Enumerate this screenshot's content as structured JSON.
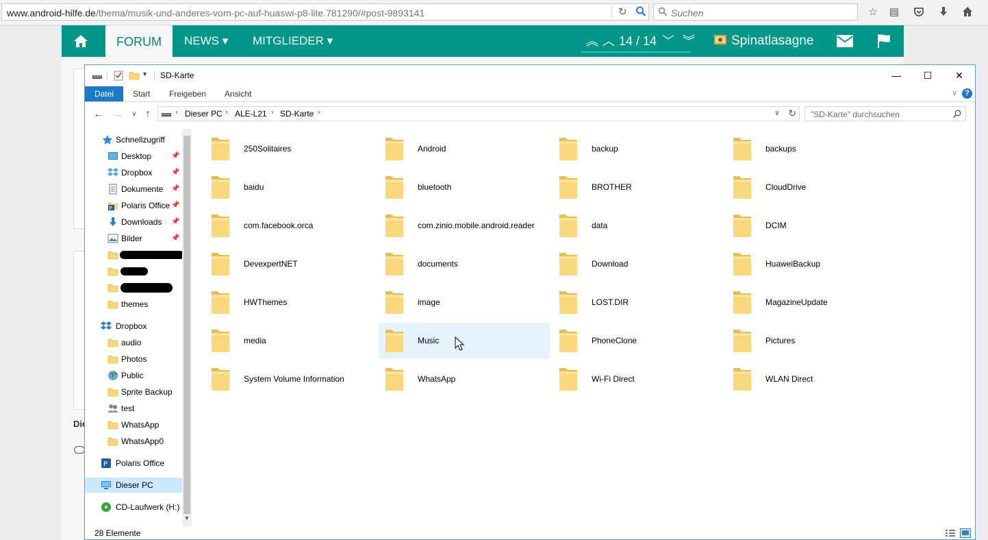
{
  "browser": {
    "url_domain": "www.android-hilfe.de",
    "url_path": "/thema/musik-und-anderes-vom-pc-auf-huaswi-p8-lite.781290/#post-9893141",
    "search_placeholder": "Suchen",
    "toolbar_icons": [
      "star-icon",
      "reading-list-icon",
      "pocket-icon",
      "download-icon",
      "home-icon"
    ]
  },
  "forum_nav": {
    "forum": "FORUM",
    "news": "NEWS ▾",
    "members": "MITGLIEDER ▾",
    "pager": "14 / 14",
    "username": "Spinatlasagne",
    "accent": "#009688"
  },
  "explorer": {
    "title": "SD-Karte",
    "tabs": [
      "Datei",
      "Start",
      "Freigeben",
      "Ansicht"
    ],
    "breadcrumb": [
      "Dieser PC",
      "ALE-L21",
      "SD-Karte"
    ],
    "search_placeholder": "\"SD-Karte\" durchsuchen",
    "nav": {
      "quick_access": "Schnellzugriff",
      "quick_items": [
        "Desktop",
        "Dropbox",
        "Dokumente",
        "Polaris Office",
        "Downloads",
        "Bilder"
      ],
      "themes": "themes",
      "dropbox": "Dropbox",
      "dropbox_items": [
        "audio",
        "Photos",
        "Public",
        "Sprite Backup",
        "test",
        "WhatsApp",
        "WhatsApp0"
      ],
      "polaris": "Polaris Office",
      "this_pc": "Dieser PC",
      "cd_drive": "CD-Laufwerk (H:)"
    },
    "folders": [
      "250Solitaires",
      "Android",
      "backup",
      "backups",
      "baidu",
      "bluetooth",
      "BROTHER",
      "CloudDrive",
      "com.facebook.orca",
      "com.zinio.mobile.android.reader",
      "data",
      "DCIM",
      "DevexpertNET",
      "documents",
      "Download",
      "HuaweiBackup",
      "HWThemes",
      "image",
      "LOST.DIR",
      "MagazineUpdate",
      "media",
      "Music",
      "PhoneClone",
      "Pictures",
      "System Volume Information",
      "WhatsApp",
      "Wi-Fi Direct",
      "WLAN Direct"
    ],
    "hovered_folder": "Music",
    "status": "28 Elemente"
  }
}
